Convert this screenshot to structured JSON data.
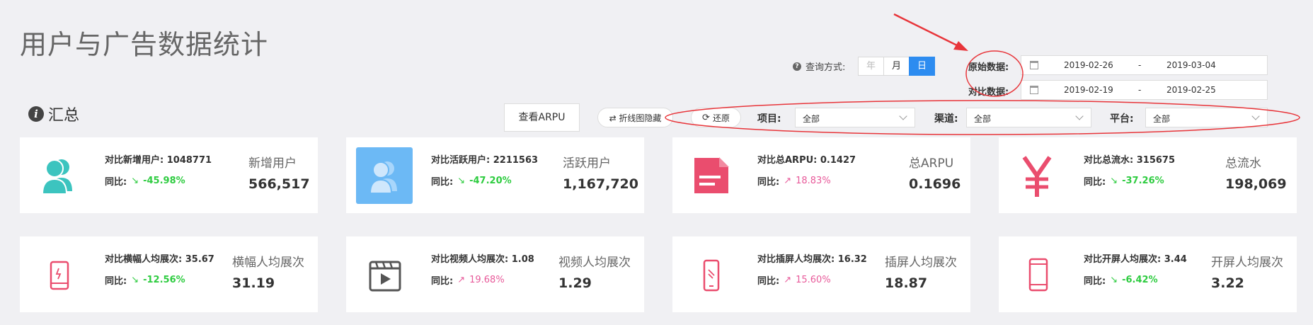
{
  "page_title": "用户与广告数据统计",
  "query": {
    "label": "查询方式:",
    "options": [
      {
        "label": "年",
        "state": "disabled"
      },
      {
        "label": "月",
        "state": "normal"
      },
      {
        "label": "日",
        "state": "active"
      }
    ]
  },
  "dates": {
    "original_label": "原始数据:",
    "original_start": "2019-02-26",
    "original_end": "2019-03-04",
    "compare_label": "对比数据:",
    "compare_start": "2019-02-19",
    "compare_end": "2019-02-25",
    "separator": "-"
  },
  "section_title": "汇总",
  "toolbar": {
    "arpu_button": "查看ARPU",
    "hide_chart": "⇄ 折线图隐藏",
    "restore": "还原"
  },
  "filters": {
    "project_label": "项目:",
    "project_value": "全部",
    "channel_label": "渠道:",
    "channel_value": "全部",
    "platform_label": "平台:",
    "platform_value": "全部"
  },
  "cards": [
    {
      "icon": "users-icon",
      "compare_label": "对比新增用户: 1048771",
      "yoy_label": "同比:",
      "dir": "down",
      "yoy": "-45.98%",
      "title": "新增用户",
      "value": "566,517"
    },
    {
      "icon": "users-box-icon",
      "compare_label": "对比活跃用户: 2211563",
      "yoy_label": "同比:",
      "dir": "down",
      "yoy": "-47.20%",
      "title": "活跃用户",
      "value": "1,167,720"
    },
    {
      "icon": "document-icon",
      "compare_label": "对比总ARPU: 0.1427",
      "yoy_label": "同比:",
      "dir": "up",
      "yoy": "18.83%",
      "title": "总ARPU",
      "value": "0.1696"
    },
    {
      "icon": "yen-icon",
      "compare_label": "对比总流水: 315675",
      "yoy_label": "同比:",
      "dir": "down",
      "yoy": "-37.26%",
      "title": "总流水",
      "value": "198,069"
    },
    {
      "icon": "tablet-icon",
      "compare_label": "对比横幅人均展次: 35.67",
      "yoy_label": "同比:",
      "dir": "down",
      "yoy": "-12.56%",
      "title": "横幅人均展次",
      "value": "31.19"
    },
    {
      "icon": "video-icon",
      "compare_label": "对比视频人均展次: 1.08",
      "yoy_label": "同比:",
      "dir": "up",
      "yoy": "19.68%",
      "title": "视频人均展次",
      "value": "1.29"
    },
    {
      "icon": "phone-icon",
      "compare_label": "对比插屏人均展次: 16.32",
      "yoy_label": "同比:",
      "dir": "up",
      "yoy": "15.60%",
      "title": "插屏人均展次",
      "value": "18.87"
    },
    {
      "icon": "mobile-icon",
      "compare_label": "对比开屏人均展次: 3.44",
      "yoy_label": "同比:",
      "dir": "down",
      "yoy": "-6.42%",
      "title": "开屏人均展次",
      "value": "3.22"
    }
  ],
  "colors": {
    "accent": "#2d8cf0",
    "up": "#e85a9a",
    "down": "#2ecc40",
    "annotation": "#e8353a",
    "teal": "#3cc4bf",
    "pink": "#ea4d6e"
  }
}
